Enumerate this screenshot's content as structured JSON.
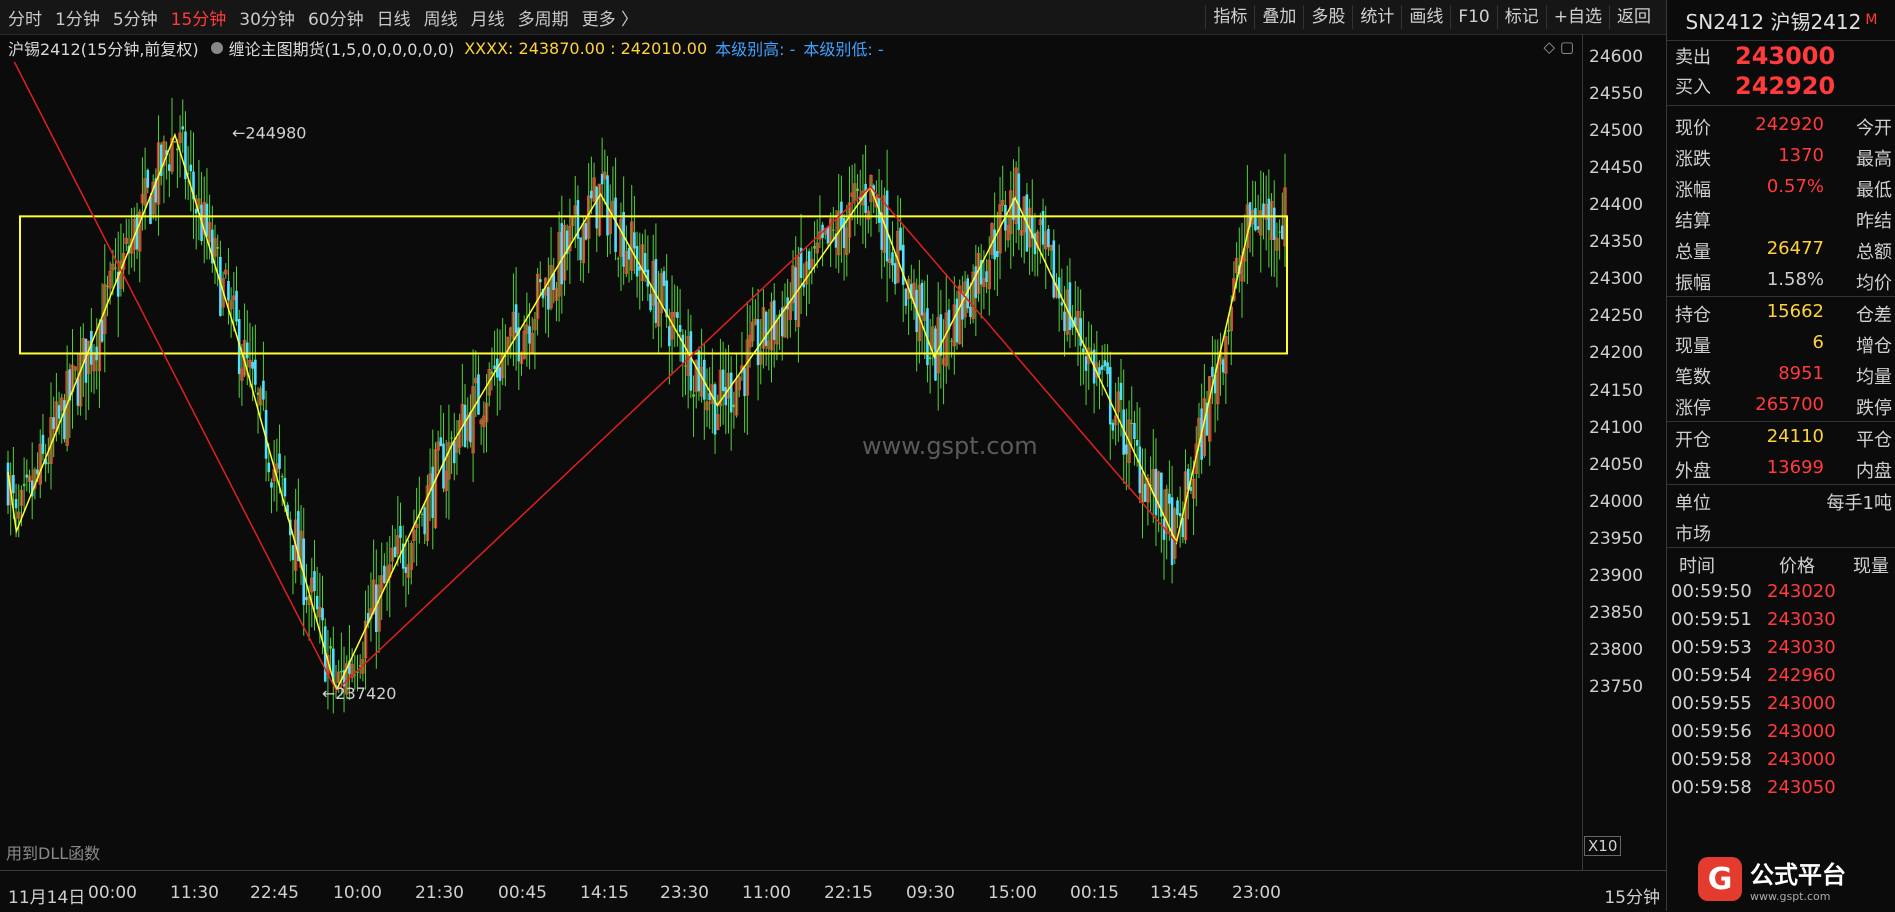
{
  "toolbar": {
    "periods": [
      "分时",
      "1分钟",
      "5分钟",
      "15分钟",
      "30分钟",
      "60分钟",
      "日线",
      "周线",
      "月线",
      "多周期",
      "更多 〉"
    ],
    "active_period": "15分钟",
    "buttons": [
      "指标",
      "叠加",
      "多股",
      "统计",
      "画线",
      "F10",
      "标记",
      "+自选",
      "返回"
    ]
  },
  "info": {
    "title": "沪锡2412(15分钟,前复权)",
    "indicator": "缠论主图期货(1,5,0,0,0,0,0,0)",
    "xxxx": "XXXX: 243870.00 : 242010.00",
    "level_high": "本级别高: -",
    "level_low": "本级别低: -",
    "tools": "◇ ▢"
  },
  "chart_data": {
    "type": "candlestick",
    "ylim": [
      23720,
      24620
    ],
    "yticks": [
      24600,
      24550,
      24500,
      24450,
      24400,
      24350,
      24300,
      24250,
      24200,
      24150,
      24100,
      24050,
      24000,
      23950,
      23900,
      23850,
      23800,
      23750
    ],
    "xticks": [
      "11月14日",
      "00:00",
      "11:30",
      "22:45",
      "10:00",
      "21:30",
      "00:45",
      "14:15",
      "23:30",
      "11:00",
      "22:15",
      "09:30",
      "15:00",
      "00:15",
      "13:45",
      "23:00"
    ],
    "period_label": "15分钟",
    "annotations": [
      {
        "text": "244980",
        "price": 24498
      },
      {
        "text": "237420",
        "price": 23742
      }
    ],
    "center_zone": {
      "top": 24385,
      "bottom": 24200
    },
    "zigzag_yellow": [
      [
        0,
        24040
      ],
      [
        3,
        23960
      ],
      [
        60,
        24495
      ],
      [
        85,
        24190
      ],
      [
        118,
        23745
      ],
      [
        160,
        24080
      ],
      [
        213,
        24415
      ],
      [
        255,
        24130
      ],
      [
        310,
        24425
      ],
      [
        333,
        24195
      ],
      [
        362,
        24410
      ],
      [
        420,
        23945
      ],
      [
        447,
        24385
      ]
    ],
    "zigzag_red": [
      [
        0,
        24610
      ],
      [
        118,
        23745
      ],
      [
        310,
        24425
      ],
      [
        420,
        23945
      ]
    ],
    "n_bars": 476
  },
  "watermark": "www.gspt.com",
  "dll_text": "用到DLL函数",
  "x10": "X10",
  "side": {
    "symbol": "SN2412 沪锡2412",
    "mark": "M",
    "sell_label": "卖出",
    "sell_value": "243000",
    "buy_label": "买入",
    "buy_value": "242920",
    "rows": [
      {
        "l": "现价",
        "v": "242920",
        "vc": "red",
        "r": "今开"
      },
      {
        "l": "涨跌",
        "v": "1370",
        "vc": "red",
        "r": "最高"
      },
      {
        "l": "涨幅",
        "v": "0.57%",
        "vc": "red",
        "r": "最低"
      },
      {
        "l": "结算",
        "v": "",
        "vc": "red",
        "r": "昨结"
      },
      {
        "l": "总量",
        "v": "26477",
        "vc": "yel",
        "r": "总额"
      },
      {
        "l": "振幅",
        "v": "1.58%",
        "vc": "plain",
        "r": "均价"
      },
      {
        "l": "持仓",
        "v": "15662",
        "vc": "yel",
        "r": "仓差"
      },
      {
        "l": "现量",
        "v": "6",
        "vc": "yel",
        "r": "增仓"
      },
      {
        "l": "笔数",
        "v": "8951",
        "vc": "red",
        "r": "均量"
      },
      {
        "l": "涨停",
        "v": "265700",
        "vc": "red",
        "r": "跌停"
      },
      {
        "l": "开仓",
        "v": "24110",
        "vc": "yel",
        "r": "平仓"
      },
      {
        "l": "外盘",
        "v": "13699",
        "vc": "red",
        "r": "内盘"
      },
      {
        "l": "单位",
        "v": "",
        "vc": "plain",
        "r": "每手1吨"
      },
      {
        "l": "市场",
        "v": "",
        "vc": "plain",
        "r": ""
      }
    ],
    "ticks_header": {
      "time": "时间",
      "price": "价格",
      "vol": "现量"
    },
    "ticks": [
      {
        "t": "00:59:50",
        "p": "243020"
      },
      {
        "t": "00:59:51",
        "p": "243030"
      },
      {
        "t": "00:59:53",
        "p": "243030"
      },
      {
        "t": "00:59:54",
        "p": "242960"
      },
      {
        "t": "00:59:55",
        "p": "243000"
      },
      {
        "t": "00:59:56",
        "p": "243000"
      },
      {
        "t": "00:59:58",
        "p": "243000"
      },
      {
        "t": "00:59:58",
        "p": "243050"
      }
    ]
  },
  "logo": {
    "name": "公式平台",
    "url": "www.gspt.com",
    "glyph": "G"
  },
  "colors": {
    "up": "#ff3b3b",
    "down": "#4fe0ff",
    "doji": "#54d23a",
    "zone": "#ffff33",
    "zigzag": "#ffff33",
    "trend": "#e02020"
  }
}
